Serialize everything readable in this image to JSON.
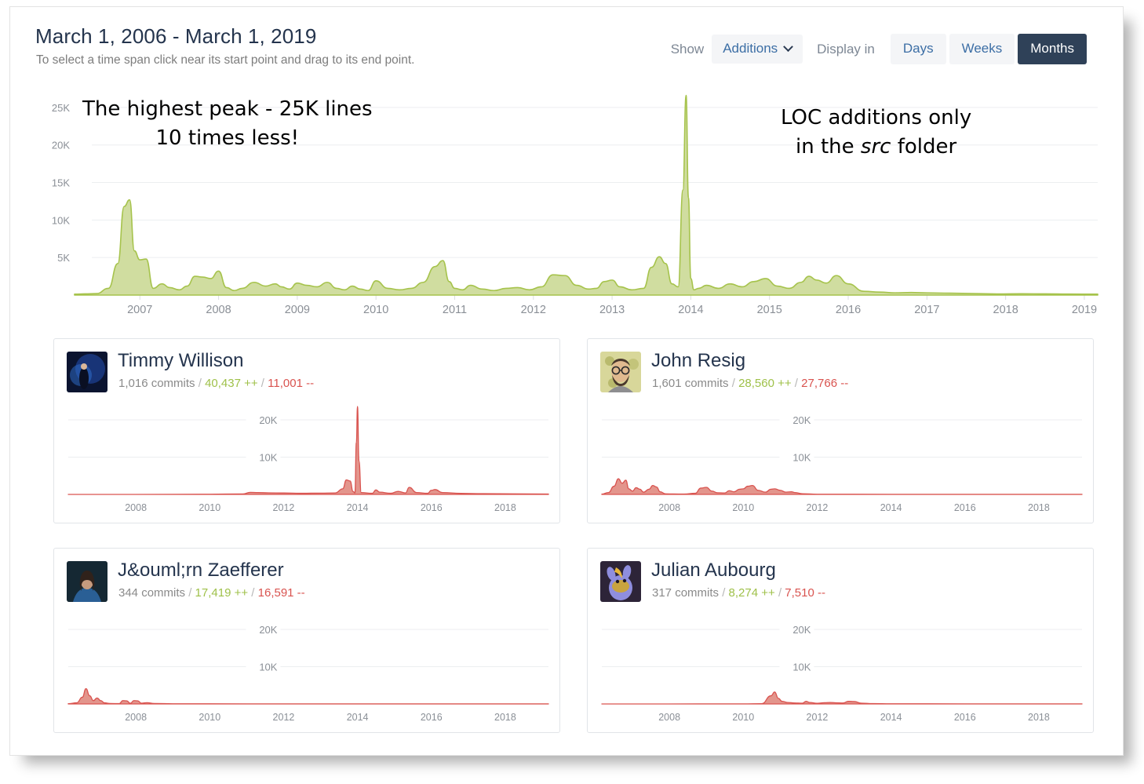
{
  "header": {
    "title": "March 1, 2006 - March 1, 2019",
    "subtitle": "To select a time span click near its start point and drag to its end point.",
    "show_label": "Show",
    "show_value": "Additions",
    "display_label": "Display in",
    "range_buttons": [
      "Days",
      "Weeks",
      "Months"
    ],
    "active_range": "Months"
  },
  "annotations": {
    "left_line1": "The highest peak - 25K lines",
    "left_line2": "10 times less!",
    "right_line1": "LOC additions only",
    "right_line2_pre": "in the ",
    "right_line2_em": "src",
    "right_line2_post": " folder"
  },
  "colors": {
    "additions": "#a6c34c",
    "additions_fill": "#cedb9b",
    "deletions": "#d9534f",
    "deletions_fill": "#e08a80",
    "accent_dark": "#2f4158",
    "link": "#3c6ea5",
    "muted": "#8a8f96"
  },
  "chart_data": [
    {
      "id": "main",
      "type": "area",
      "title": "March 1, 2006 - March 1, 2019",
      "xlabel": "",
      "ylabel": "",
      "grid": true,
      "ylim": [
        0,
        27500
      ],
      "yticks": [
        5000,
        10000,
        15000,
        20000,
        25000
      ],
      "ytick_labels": [
        "5K",
        "10K",
        "15K",
        "20K",
        "25K"
      ],
      "xticks": [
        2007,
        2008,
        2009,
        2010,
        2011,
        2012,
        2013,
        2014,
        2015,
        2016,
        2017,
        2018,
        2019
      ],
      "xtick_labels": [
        "2007",
        "2008",
        "2009",
        "2010",
        "2011",
        "2012",
        "2013",
        "2014",
        "2015",
        "2016",
        "2017",
        "2018",
        "2019"
      ],
      "xlim": [
        2006.17,
        2019.17
      ],
      "series": [
        {
          "name": "Additions",
          "color": "#a6c34c",
          "x": [
            2006.17,
            2006.3,
            2006.45,
            2006.6,
            2006.72,
            2006.8,
            2006.87,
            2006.93,
            2007.0,
            2007.08,
            2007.17,
            2007.28,
            2007.38,
            2007.5,
            2007.6,
            2007.7,
            2007.8,
            2007.9,
            2008.0,
            2008.1,
            2008.2,
            2008.3,
            2008.45,
            2008.6,
            2008.72,
            2008.8,
            2008.9,
            2009.0,
            2009.12,
            2009.25,
            2009.38,
            2009.5,
            2009.6,
            2009.7,
            2009.8,
            2009.9,
            2010.0,
            2010.15,
            2010.3,
            2010.45,
            2010.6,
            2010.75,
            2010.85,
            2010.93,
            2011.0,
            2011.1,
            2011.2,
            2011.35,
            2011.5,
            2011.65,
            2011.8,
            2011.95,
            2012.1,
            2012.25,
            2012.4,
            2012.55,
            2012.7,
            2012.8,
            2012.9,
            2013.0,
            2013.1,
            2013.25,
            2013.4,
            2013.5,
            2013.6,
            2013.68,
            2013.76,
            2013.84,
            2013.9,
            2013.94,
            2013.97,
            2014.0,
            2014.04,
            2014.1,
            2014.2,
            2014.35,
            2014.5,
            2014.65,
            2014.8,
            2014.95,
            2015.1,
            2015.25,
            2015.4,
            2015.5,
            2015.6,
            2015.72,
            2015.85,
            2016.0,
            2016.2,
            2016.4,
            2016.6,
            2016.8,
            2017.0,
            2017.3,
            2017.6,
            2017.9,
            2018.2,
            2018.5,
            2018.8,
            2019.17
          ],
          "y": [
            120,
            160,
            200,
            900,
            4200,
            11800,
            12700,
            5900,
            4700,
            4800,
            900,
            1500,
            1000,
            700,
            1200,
            2500,
            2400,
            2200,
            3200,
            1000,
            600,
            900,
            1700,
            1200,
            1500,
            1100,
            800,
            1600,
            1300,
            1100,
            1700,
            900,
            700,
            1200,
            800,
            600,
            1900,
            900,
            700,
            900,
            1700,
            3800,
            4600,
            1800,
            900,
            700,
            1300,
            800,
            600,
            900,
            1000,
            700,
            1100,
            2700,
            2600,
            1300,
            800,
            900,
            1800,
            2000,
            1100,
            700,
            900,
            3700,
            5100,
            4200,
            1500,
            1100,
            14000,
            26600,
            13000,
            2200,
            700,
            900,
            1300,
            900,
            1500,
            1100,
            1800,
            2200,
            1200,
            900,
            1700,
            2500,
            2000,
            1600,
            2600,
            1500,
            500,
            400,
            300,
            350,
            300,
            250,
            200,
            150,
            180,
            160,
            140,
            120
          ]
        }
      ]
    },
    {
      "id": "timmy-willison",
      "type": "area",
      "title": "Timmy Willison",
      "grid": true,
      "ylim": [
        0,
        24000
      ],
      "yticks": [
        10000,
        20000
      ],
      "ytick_labels": [
        "10K",
        "20K"
      ],
      "xticks": [
        2008,
        2010,
        2012,
        2014,
        2016,
        2018
      ],
      "xtick_labels": [
        "2008",
        "2010",
        "2012",
        "2014",
        "2016",
        "2018"
      ],
      "xlim": [
        2006.17,
        2019.17
      ],
      "series": [
        {
          "name": "Additions",
          "color": "#d9534f",
          "x": [
            2006.17,
            2008,
            2010,
            2010.9,
            2011.1,
            2011.3,
            2011.6,
            2012,
            2012.5,
            2013,
            2013.4,
            2013.6,
            2013.7,
            2013.8,
            2013.88,
            2013.93,
            2013.97,
            2014.0,
            2014.04,
            2014.1,
            2014.4,
            2014.5,
            2014.6,
            2014.9,
            2015.1,
            2015.3,
            2015.4,
            2015.6,
            2015.9,
            2016.0,
            2016.1,
            2016.3,
            2016.8,
            2017.4,
            2018.2,
            2019.17
          ],
          "y": [
            0,
            0,
            60,
            120,
            550,
            500,
            420,
            380,
            300,
            350,
            400,
            1500,
            3900,
            3600,
            800,
            400,
            14000,
            23600,
            9000,
            500,
            300,
            1200,
            600,
            300,
            800,
            400,
            1900,
            500,
            300,
            1100,
            1300,
            500,
            280,
            200,
            150,
            100
          ]
        }
      ]
    },
    {
      "id": "john-resig",
      "type": "area",
      "title": "John Resig",
      "grid": true,
      "ylim": [
        0,
        24000
      ],
      "yticks": [
        10000,
        20000
      ],
      "ytick_labels": [
        "10K",
        "20K"
      ],
      "xticks": [
        2008,
        2010,
        2012,
        2014,
        2016,
        2018
      ],
      "xtick_labels": [
        "2008",
        "2010",
        "2012",
        "2014",
        "2016",
        "2018"
      ],
      "xlim": [
        2006.17,
        2019.17
      ],
      "series": [
        {
          "name": "Additions",
          "color": "#d9534f",
          "x": [
            2006.17,
            2006.35,
            2006.5,
            2006.62,
            2006.72,
            2006.82,
            2006.9,
            2007.0,
            2007.1,
            2007.2,
            2007.3,
            2007.45,
            2007.55,
            2007.65,
            2007.75,
            2007.9,
            2008.1,
            2008.4,
            2008.7,
            2008.85,
            2009.0,
            2009.15,
            2009.3,
            2009.5,
            2009.62,
            2009.75,
            2009.9,
            2010.0,
            2010.12,
            2010.25,
            2010.4,
            2010.6,
            2010.75,
            2010.85,
            2011.0,
            2011.15,
            2011.3,
            2011.4,
            2011.6,
            2012,
            2014,
            2016,
            2018,
            2019.17
          ],
          "y": [
            80,
            500,
            2200,
            4200,
            3000,
            3800,
            1500,
            900,
            1800,
            1400,
            600,
            1400,
            2400,
            2000,
            700,
            150,
            120,
            100,
            300,
            1700,
            1900,
            900,
            450,
            400,
            1000,
            700,
            1400,
            1500,
            2200,
            2400,
            1100,
            600,
            1400,
            1500,
            1100,
            600,
            700,
            500,
            180,
            60,
            30,
            20,
            15,
            10
          ]
        }
      ]
    },
    {
      "id": "jorn-zaefferer",
      "type": "area",
      "title": "J&ouml;rn Zaefferer",
      "grid": true,
      "ylim": [
        0,
        24000
      ],
      "yticks": [
        10000,
        20000
      ],
      "ytick_labels": [
        "10K",
        "20K"
      ],
      "xticks": [
        2008,
        2010,
        2012,
        2014,
        2016,
        2018
      ],
      "xtick_labels": [
        "2008",
        "2010",
        "2012",
        "2014",
        "2016",
        "2018"
      ],
      "xlim": [
        2006.17,
        2019.17
      ],
      "series": [
        {
          "name": "Additions",
          "color": "#d9534f",
          "x": [
            2006.17,
            2006.4,
            2006.55,
            2006.65,
            2006.75,
            2006.85,
            2006.95,
            2007.05,
            2007.15,
            2007.3,
            2007.55,
            2007.65,
            2007.75,
            2007.85,
            2007.95,
            2008.05,
            2008.15,
            2008.3,
            2008.5,
            2009,
            2010,
            2012,
            2014,
            2016,
            2018,
            2019.17
          ],
          "y": [
            80,
            300,
            1800,
            4100,
            2200,
            900,
            1600,
            900,
            300,
            120,
            100,
            900,
            850,
            180,
            900,
            850,
            200,
            350,
            120,
            60,
            40,
            25,
            20,
            15,
            12,
            10
          ]
        }
      ]
    },
    {
      "id": "julian-aubourg",
      "type": "area",
      "title": "Julian Aubourg",
      "grid": true,
      "ylim": [
        0,
        24000
      ],
      "yticks": [
        10000,
        20000
      ],
      "ytick_labels": [
        "10K",
        "20K"
      ],
      "xticks": [
        2008,
        2010,
        2012,
        2014,
        2016,
        2018
      ],
      "xtick_labels": [
        "2008",
        "2010",
        "2012",
        "2014",
        "2016",
        "2018"
      ],
      "xlim": [
        2006.17,
        2019.17
      ],
      "series": [
        {
          "name": "Additions",
          "color": "#d9534f",
          "x": [
            2006.17,
            2008,
            2010,
            2010.5,
            2010.75,
            2010.85,
            2010.95,
            2011.05,
            2011.2,
            2011.4,
            2011.6,
            2011.7,
            2011.8,
            2012.0,
            2012.2,
            2012.35,
            2012.5,
            2012.7,
            2012.85,
            2013.0,
            2013.2,
            2013.5,
            2014,
            2016,
            2018,
            2019.17
          ],
          "y": [
            0,
            0,
            30,
            80,
            2200,
            3200,
            1500,
            700,
            400,
            260,
            200,
            700,
            400,
            180,
            350,
            400,
            320,
            260,
            700,
            650,
            200,
            90,
            50,
            30,
            20,
            15
          ]
        }
      ]
    }
  ],
  "contributors": [
    {
      "name": "Timmy Willison",
      "commits": "1,016 commits",
      "additions": "40,437 ++",
      "deletions": "11,001 --",
      "avatar": "avatar-timmy-willison",
      "chart_id": "timmy-willison"
    },
    {
      "name": "John Resig",
      "commits": "1,601 commits",
      "additions": "28,560 ++",
      "deletions": "27,766 --",
      "avatar": "avatar-john-resig",
      "chart_id": "john-resig"
    },
    {
      "name": "J&ouml;rn Zaefferer",
      "commits": "344 commits",
      "additions": "17,419 ++",
      "deletions": "16,591 --",
      "avatar": "avatar-jorn-zaefferer",
      "chart_id": "jorn-zaefferer"
    },
    {
      "name": "Julian Aubourg",
      "commits": "317 commits",
      "additions": "8,274 ++",
      "deletions": "7,510 --",
      "avatar": "avatar-julian-aubourg",
      "chart_id": "julian-aubourg"
    }
  ]
}
